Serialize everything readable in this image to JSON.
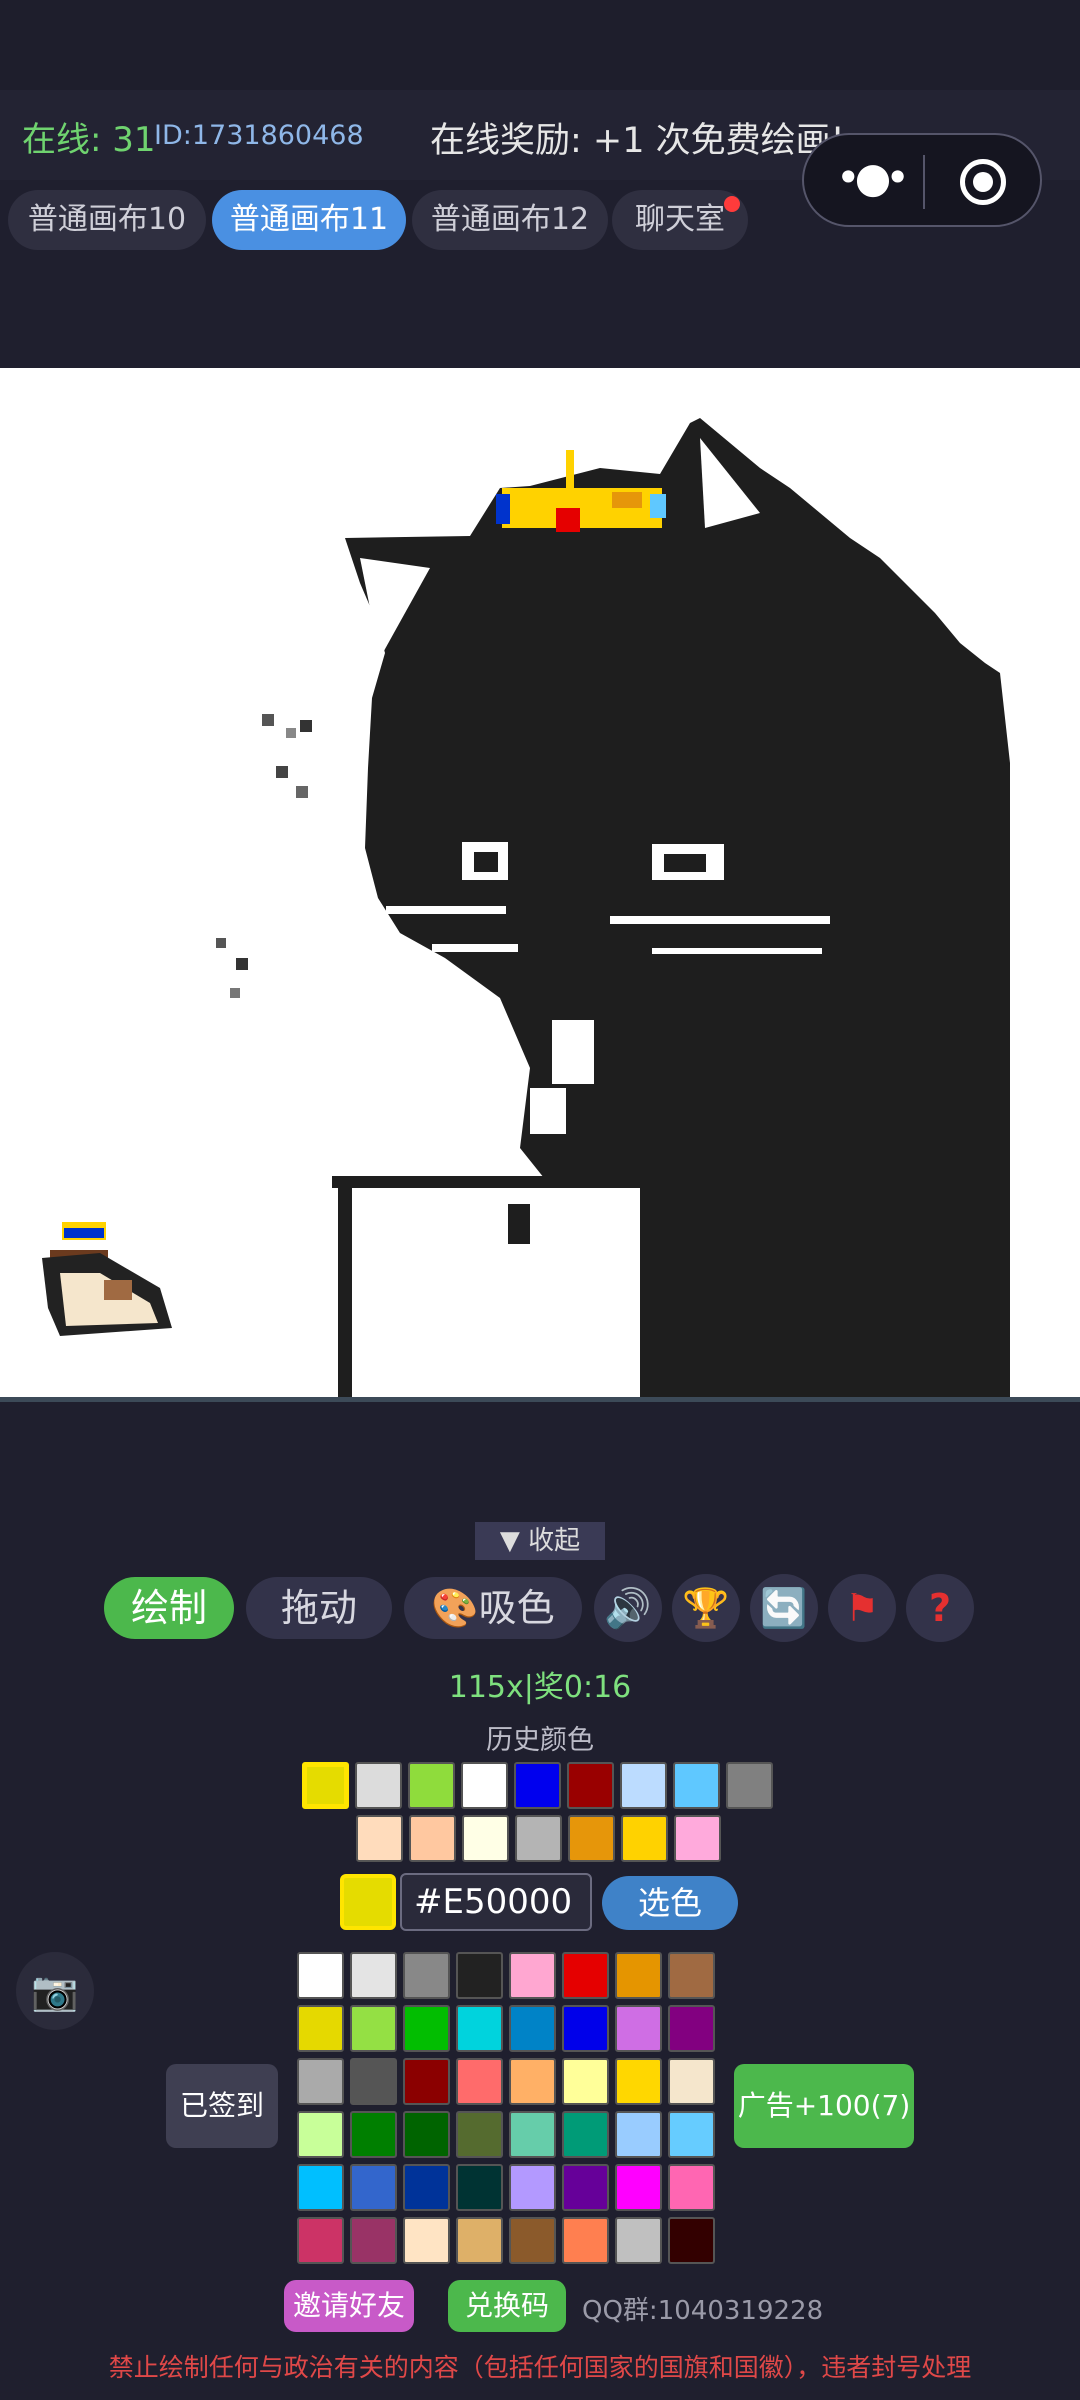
{
  "header": {
    "online": "在线: 31",
    "user_id": "ID:1731860468",
    "reward": "在线奖励: +1 次免费绘画!"
  },
  "tabs": [
    {
      "label": "普通画布10",
      "active": false
    },
    {
      "label": "普通画布11",
      "active": true
    },
    {
      "label": "普通画布12",
      "active": false
    },
    {
      "label": "聊天室",
      "active": false,
      "badge": true
    }
  ],
  "collapse_label": "▼ 收起",
  "toolbar": {
    "draw": "绘制",
    "drag": "拖动",
    "eyedrop": "🎨吸色",
    "icons": [
      "speaker-icon",
      "trophy-icon",
      "refresh-icon",
      "flag-icon",
      "help-icon"
    ]
  },
  "counter": "115x|奖0:16",
  "history_title": "历史颜色",
  "history_colors": [
    [
      "#e5dc00",
      "#dcdcdc",
      "#8fdc3c",
      "#ffffff",
      "#0000ee",
      "#990000",
      "#bcdcff",
      "#5fc8ff",
      "#808080"
    ],
    [
      "#ffdcbc",
      "#ffc8a0",
      "#ffffe6",
      "#b4b4b4",
      "#e6960a",
      "#ffd200",
      "#ffaadc"
    ]
  ],
  "current_color_hex": "#E50000",
  "pick_color_label": "选色",
  "palette": [
    [
      "#ffffff",
      "#e4e4e4",
      "#888888",
      "#222222",
      "#ffa7d1",
      "#e50000",
      "#e59500",
      "#a06a42"
    ],
    [
      "#e5d900",
      "#94e044",
      "#02be01",
      "#00d3dd",
      "#0083c7",
      "#0000ea",
      "#cf6ee4",
      "#820080"
    ],
    [
      "#aaaaaa",
      "#555555",
      "#8b0000",
      "#ff6b6b",
      "#ffb066",
      "#ffff99",
      "#ffd700",
      "#f5e6cc"
    ],
    [
      "#c8ff99",
      "#007f00",
      "#006400",
      "#556b2f",
      "#66cdaa",
      "#009b77",
      "#99ccff",
      "#66ccff"
    ],
    [
      "#00bfff",
      "#3366cc",
      "#003399",
      "#003333",
      "#b399ff",
      "#660099",
      "#ff00ff",
      "#ff66b2"
    ],
    [
      "#cc3366",
      "#993366",
      "#ffe4c4",
      "#deb068",
      "#8b5a2b",
      "#ff7f50",
      "#c0c0c0",
      "#330000"
    ]
  ],
  "signed_label": "已签到",
  "ad_label": "广告+100(7)",
  "invite_label": "邀请好友",
  "redeem_label": "兑换码",
  "qq_group": "QQ群:1040319228",
  "warning": "禁止绘制任何与政治有关的内容（包括任何国家的国旗和国徽），违者封号处理"
}
